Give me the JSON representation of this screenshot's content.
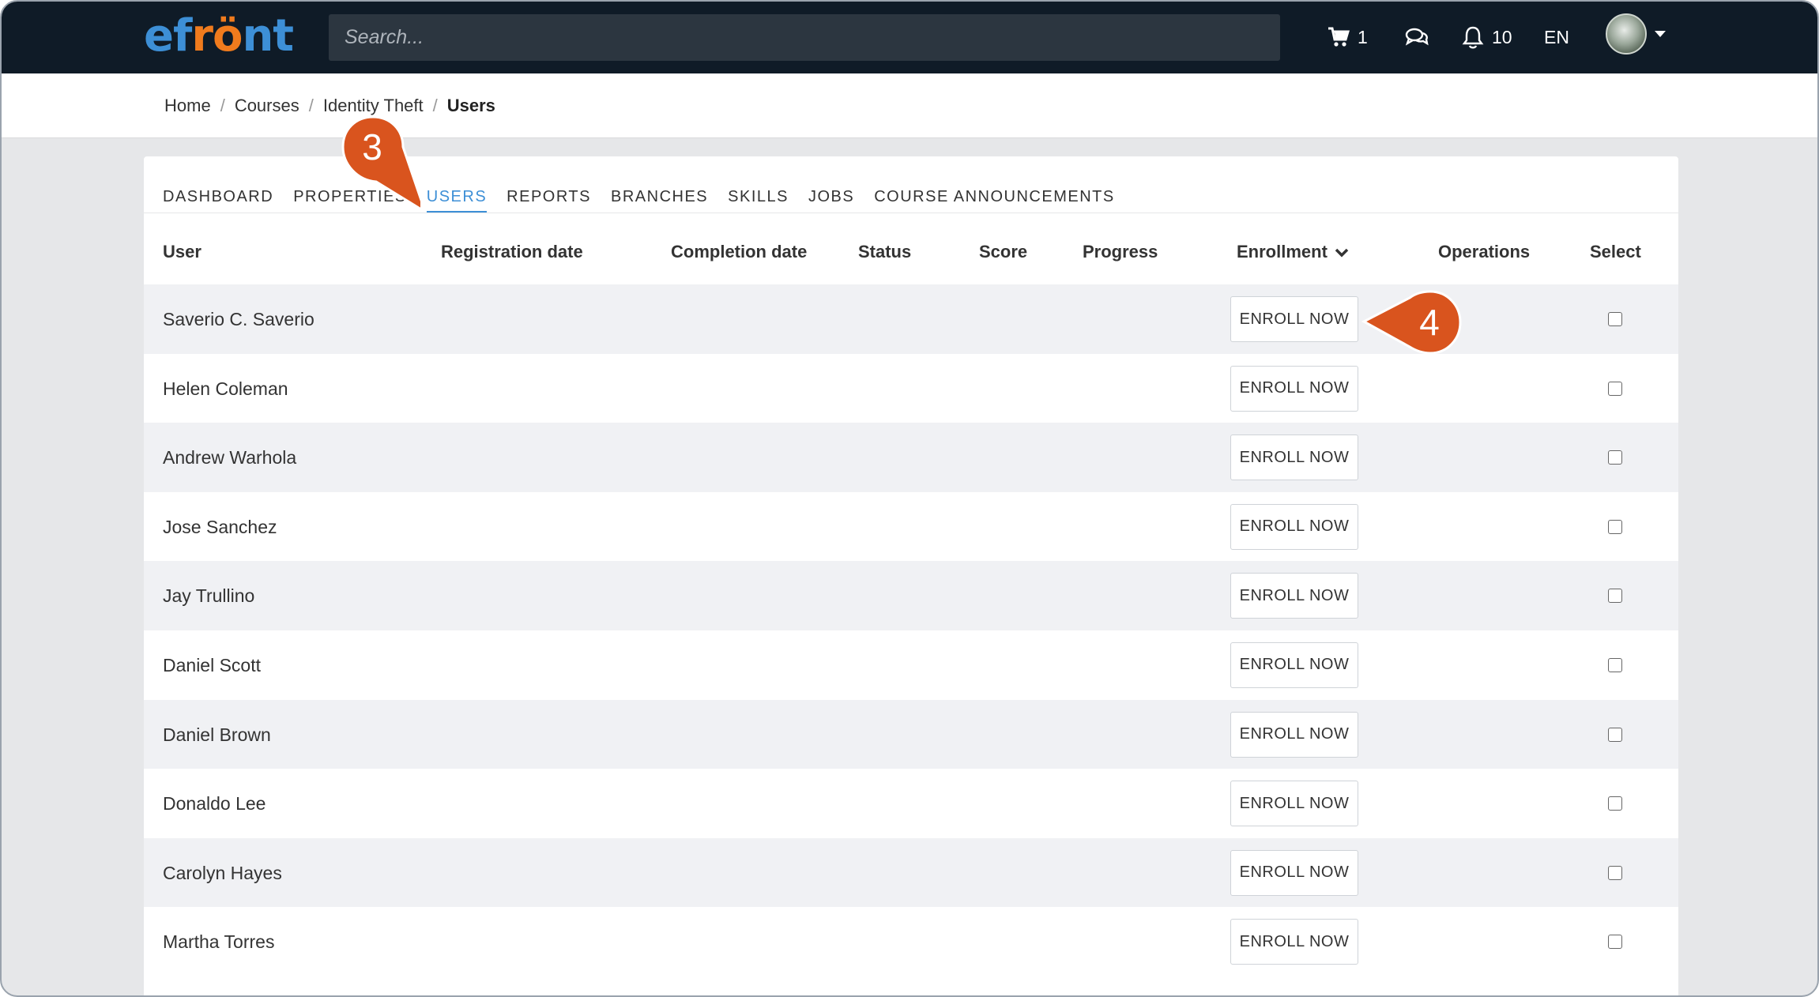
{
  "brand": {
    "logo_ef": "ef",
    "logo_ro": "rö",
    "logo_nt": "nt"
  },
  "topbar": {
    "search_placeholder": "Search...",
    "cart_count": "1",
    "notifications_count": "10",
    "language": "EN"
  },
  "breadcrumb": {
    "items": [
      "Home",
      "Courses",
      "Identity Theft"
    ],
    "current": "Users",
    "separator": "/"
  },
  "tabs": [
    "DASHBOARD",
    "PROPERTIES",
    "USERS",
    "REPORTS",
    "BRANCHES",
    "SKILLS",
    "JOBS",
    "COURSE ANNOUNCEMENTS"
  ],
  "active_tab": "USERS",
  "table": {
    "headers": {
      "user": "User",
      "registration_date": "Registration date",
      "completion_date": "Completion date",
      "status": "Status",
      "score": "Score",
      "progress": "Progress",
      "enrollment": "Enrollment",
      "operations": "Operations",
      "select": "Select"
    },
    "enroll_label": "ENROLL NOW",
    "rows": [
      "Saverio C. Saverio",
      "Helen Coleman",
      "Andrew Warhola",
      "Jose Sanchez",
      "Jay Trullino",
      "Daniel Scott",
      "Daniel Brown",
      "Donaldo Lee",
      "Carolyn Hayes",
      "Martha Torres"
    ]
  },
  "annotations": {
    "step_tab": "3",
    "step_enroll": "4",
    "color": "#d9541e"
  },
  "colors": {
    "topbar": "#0f1b27",
    "accent": "#3d8fd6",
    "logo_orange": "#f07b1d"
  }
}
